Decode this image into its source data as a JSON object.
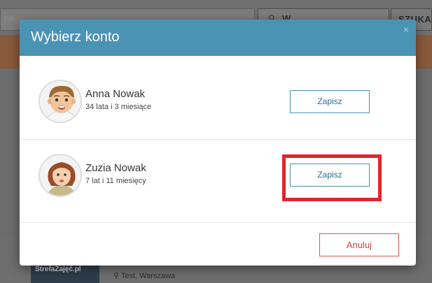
{
  "background": {
    "search_partial": "zuk",
    "where_partial": "W",
    "search_button_partial": "SZUKA",
    "brand": "StrefaZajęć.pl",
    "address": "Test, Warszawa"
  },
  "modal": {
    "title": "Wybierz konto",
    "close_symbol": "×",
    "accounts": [
      {
        "name": "Anna Nowak",
        "age": "34 lata i 3 miesiące",
        "button": "Zapisz",
        "avatar": "man-avatar-icon"
      },
      {
        "name": "Zuzia Nowak",
        "age": "7 lat i 11 miesięcy",
        "button": "Zapisz",
        "avatar": "girl-avatar-icon",
        "highlighted": true
      }
    ],
    "cancel_label": "Anuluj"
  },
  "colors": {
    "header": "#4a93b4",
    "highlight": "#e0252c",
    "cancel": "#d9574e"
  }
}
